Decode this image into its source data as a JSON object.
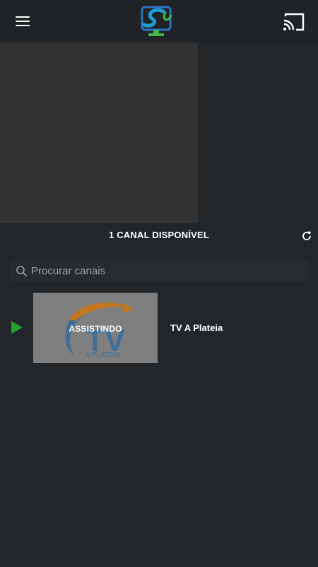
{
  "app": {
    "logo_icon": "tv-logo-icon",
    "menu_icon": "hamburger-menu-icon",
    "cast_icon": "cast-icon"
  },
  "channels_header": {
    "count_label": "1 CANAL DISPONÍVEL",
    "refresh_icon": "refresh-icon"
  },
  "search": {
    "placeholder": "Procurar canais",
    "value": "",
    "icon": "search-icon"
  },
  "channels": [
    {
      "name": "TV A Plateia",
      "status": "ASSISTINDO",
      "thumbnail_text": "A PLATEIA",
      "thumbnail_logo": "TV",
      "playing": true
    }
  ],
  "colors": {
    "background": "#222629",
    "topbar": "#1f2326",
    "player": "#323232",
    "play_accent": "#1fa32c",
    "logo_blue": "#2d74c4",
    "logo_green": "#45b649"
  }
}
